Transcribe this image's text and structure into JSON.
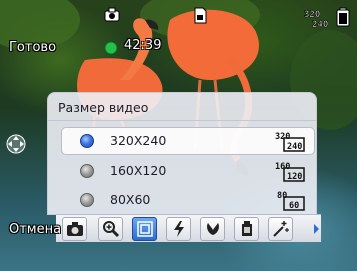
{
  "status": {
    "ready_label": "Готово",
    "timer": "42:39",
    "resolution_badge_top": "320",
    "resolution_badge_bottom": "240"
  },
  "dialog": {
    "title": "Размер видео",
    "options": [
      {
        "label": "320X240",
        "badge_top": "320",
        "badge_bottom": "240",
        "selected": true
      },
      {
        "label": "160X120",
        "badge_top": "160",
        "badge_bottom": "120",
        "selected": false
      },
      {
        "label": "80X60",
        "badge_top": "80",
        "badge_bottom": "60",
        "selected": false
      }
    ]
  },
  "softkeys": {
    "cancel_label": "Отмена"
  },
  "toolbar": {
    "tools": [
      {
        "icon": "camera-mode-icon",
        "active": false
      },
      {
        "icon": "zoom-icon",
        "active": false
      },
      {
        "icon": "video-size-icon",
        "active": true
      },
      {
        "icon": "flash-icon",
        "active": false
      },
      {
        "icon": "macro-icon",
        "active": false
      },
      {
        "icon": "white-balance-icon",
        "active": false
      },
      {
        "icon": "effects-icon",
        "active": false
      }
    ],
    "more_icon": "chevron-right-icon"
  },
  "colors": {
    "accent": "#3f78e0",
    "record_dot": "#22c24a"
  }
}
